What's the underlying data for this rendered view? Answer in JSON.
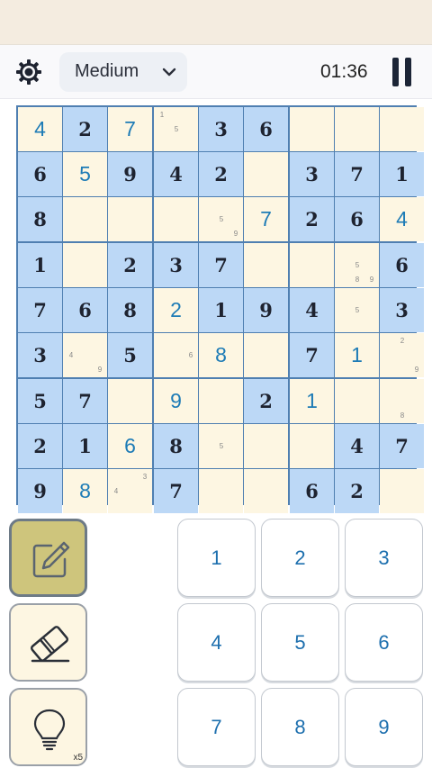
{
  "header": {
    "difficulty": "Medium",
    "timer": "01:36",
    "icons": [
      "gear-icon",
      "chevron-down-icon",
      "pause-icon"
    ]
  },
  "board": {
    "colors": {
      "cream": "#fdf6e2",
      "blue": "#bcd8f6",
      "given": "#1e2330",
      "user": "#1d7bb6",
      "line": "#4f7fb1"
    },
    "rows": [
      [
        {
          "v": "4",
          "t": "user",
          "c": "cream"
        },
        {
          "v": "2",
          "t": "given",
          "c": "blue"
        },
        {
          "v": "7",
          "t": "user",
          "c": "cream"
        },
        {
          "v": "",
          "t": "empty",
          "c": "cream",
          "n": [
            "1",
            "5"
          ]
        },
        {
          "v": "3",
          "t": "given",
          "c": "blue"
        },
        {
          "v": "6",
          "t": "given",
          "c": "blue"
        },
        {
          "v": "",
          "t": "empty",
          "c": "cream"
        },
        {
          "v": "",
          "t": "empty",
          "c": "cream"
        },
        {
          "v": "",
          "t": "empty",
          "c": "cream"
        }
      ],
      [
        {
          "v": "6",
          "t": "given",
          "c": "blue"
        },
        {
          "v": "5",
          "t": "user",
          "c": "cream"
        },
        {
          "v": "9",
          "t": "given",
          "c": "blue"
        },
        {
          "v": "4",
          "t": "given",
          "c": "blue"
        },
        {
          "v": "2",
          "t": "given",
          "c": "blue"
        },
        {
          "v": "",
          "t": "empty",
          "c": "cream"
        },
        {
          "v": "3",
          "t": "given",
          "c": "blue"
        },
        {
          "v": "7",
          "t": "given",
          "c": "blue"
        },
        {
          "v": "1",
          "t": "given",
          "c": "blue"
        }
      ],
      [
        {
          "v": "8",
          "t": "given",
          "c": "blue"
        },
        {
          "v": "",
          "t": "empty",
          "c": "cream"
        },
        {
          "v": "",
          "t": "empty",
          "c": "cream"
        },
        {
          "v": "",
          "t": "empty",
          "c": "cream"
        },
        {
          "v": "",
          "t": "empty",
          "c": "cream",
          "n": [
            "5",
            "9"
          ]
        },
        {
          "v": "7",
          "t": "user",
          "c": "cream"
        },
        {
          "v": "2",
          "t": "given",
          "c": "blue"
        },
        {
          "v": "6",
          "t": "given",
          "c": "blue"
        },
        {
          "v": "4",
          "t": "user",
          "c": "cream"
        }
      ],
      [
        {
          "v": "1",
          "t": "given",
          "c": "blue"
        },
        {
          "v": "",
          "t": "empty",
          "c": "cream"
        },
        {
          "v": "2",
          "t": "given",
          "c": "blue"
        },
        {
          "v": "3",
          "t": "given",
          "c": "blue"
        },
        {
          "v": "7",
          "t": "given",
          "c": "blue"
        },
        {
          "v": "",
          "t": "empty",
          "c": "cream"
        },
        {
          "v": "",
          "t": "empty",
          "c": "cream"
        },
        {
          "v": "",
          "t": "empty",
          "c": "cream",
          "n": [
            "5",
            "8",
            "9"
          ]
        },
        {
          "v": "6",
          "t": "given",
          "c": "blue"
        }
      ],
      [
        {
          "v": "7",
          "t": "given",
          "c": "blue"
        },
        {
          "v": "6",
          "t": "given",
          "c": "blue"
        },
        {
          "v": "8",
          "t": "given",
          "c": "blue"
        },
        {
          "v": "2",
          "t": "user",
          "c": "cream"
        },
        {
          "v": "1",
          "t": "given",
          "c": "blue"
        },
        {
          "v": "9",
          "t": "given",
          "c": "blue"
        },
        {
          "v": "4",
          "t": "given",
          "c": "blue"
        },
        {
          "v": "",
          "t": "empty",
          "c": "cream",
          "n": [
            "5"
          ]
        },
        {
          "v": "3",
          "t": "given",
          "c": "blue"
        }
      ],
      [
        {
          "v": "3",
          "t": "given",
          "c": "blue"
        },
        {
          "v": "",
          "t": "empty",
          "c": "cream",
          "n": [
            "4",
            "9"
          ]
        },
        {
          "v": "5",
          "t": "given",
          "c": "blue"
        },
        {
          "v": "",
          "t": "empty",
          "c": "cream",
          "n": [
            "6"
          ]
        },
        {
          "v": "8",
          "t": "user",
          "c": "cream"
        },
        {
          "v": "",
          "t": "empty",
          "c": "cream"
        },
        {
          "v": "7",
          "t": "given",
          "c": "blue"
        },
        {
          "v": "1",
          "t": "user",
          "c": "cream"
        },
        {
          "v": "",
          "t": "empty",
          "c": "cream",
          "n": [
            "2",
            "9"
          ]
        }
      ],
      [
        {
          "v": "5",
          "t": "given",
          "c": "blue"
        },
        {
          "v": "7",
          "t": "given",
          "c": "blue"
        },
        {
          "v": "",
          "t": "empty",
          "c": "cream"
        },
        {
          "v": "9",
          "t": "user",
          "c": "cream"
        },
        {
          "v": "",
          "t": "empty",
          "c": "cream"
        },
        {
          "v": "2",
          "t": "given",
          "c": "blue"
        },
        {
          "v": "1",
          "t": "user",
          "c": "cream"
        },
        {
          "v": "",
          "t": "empty",
          "c": "cream"
        },
        {
          "v": "",
          "t": "empty",
          "c": "cream",
          "n": [
            "8"
          ]
        }
      ],
      [
        {
          "v": "2",
          "t": "given",
          "c": "blue"
        },
        {
          "v": "1",
          "t": "given",
          "c": "blue"
        },
        {
          "v": "6",
          "t": "user",
          "c": "cream"
        },
        {
          "v": "8",
          "t": "given",
          "c": "blue"
        },
        {
          "v": "",
          "t": "empty",
          "c": "cream",
          "n": [
            "5"
          ]
        },
        {
          "v": "",
          "t": "empty",
          "c": "cream"
        },
        {
          "v": "",
          "t": "empty",
          "c": "cream"
        },
        {
          "v": "4",
          "t": "given",
          "c": "blue"
        },
        {
          "v": "7",
          "t": "given",
          "c": "blue"
        }
      ],
      [
        {
          "v": "9",
          "t": "given",
          "c": "blue"
        },
        {
          "v": "8",
          "t": "user",
          "c": "cream"
        },
        {
          "v": "",
          "t": "empty",
          "c": "cream",
          "n": [
            "3",
            "4"
          ]
        },
        {
          "v": "7",
          "t": "given",
          "c": "blue"
        },
        {
          "v": "",
          "t": "empty",
          "c": "cream"
        },
        {
          "v": "",
          "t": "empty",
          "c": "cream"
        },
        {
          "v": "6",
          "t": "given",
          "c": "blue"
        },
        {
          "v": "2",
          "t": "given",
          "c": "blue"
        },
        {
          "v": "",
          "t": "empty",
          "c": "cream"
        }
      ]
    ]
  },
  "tools": {
    "pencil": {
      "icon": "pencil-icon",
      "active": true
    },
    "eraser": {
      "icon": "eraser-icon"
    },
    "hint": {
      "icon": "lightbulb-icon",
      "count": "x5"
    }
  },
  "keypad": [
    "1",
    "2",
    "3",
    "4",
    "5",
    "6",
    "7",
    "8",
    "9"
  ]
}
